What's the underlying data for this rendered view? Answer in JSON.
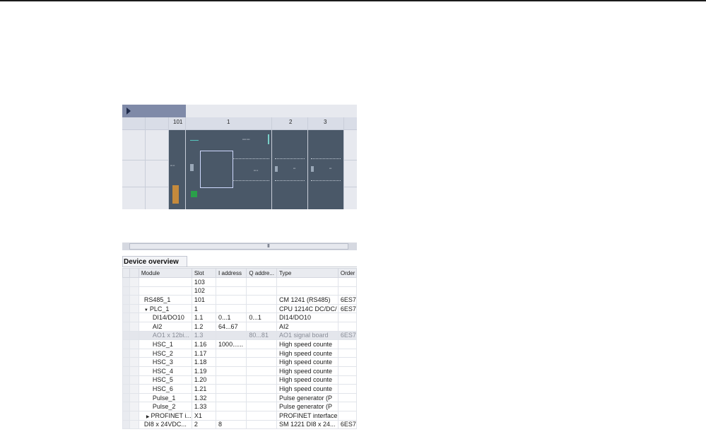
{
  "device_view": {
    "slot_numbers": [
      "101",
      "1",
      "2",
      "3"
    ]
  },
  "scrollbar": {
    "grip": "III"
  },
  "overview": {
    "title": "Device overview",
    "columns": [
      "Module",
      "Slot",
      "I address",
      "Q addre...",
      "Type",
      "Order"
    ],
    "rows": [
      {
        "module": "",
        "slot": "103",
        "i": "",
        "q": "",
        "type": "",
        "order": "",
        "indent": 0
      },
      {
        "module": "",
        "slot": "102",
        "i": "",
        "q": "",
        "type": "",
        "order": "",
        "indent": 0
      },
      {
        "module": "RS485_1",
        "slot": "101",
        "i": "",
        "q": "",
        "type": "CM 1241 (RS485)",
        "order": "6ES7",
        "indent": 1
      },
      {
        "module": "PLC_1",
        "slot": "1",
        "i": "",
        "q": "",
        "type": "CPU 1214C DC/DC/",
        "order": "6ES7",
        "indent": 0,
        "caret": "▼"
      },
      {
        "module": "DI14/DO10",
        "slot": "1.1",
        "i": "0...1",
        "q": "0...1",
        "type": "DI14/DO10",
        "order": "",
        "indent": 2
      },
      {
        "module": "AI2",
        "slot": "1.2",
        "i": "64...67",
        "q": "",
        "type": "AI2",
        "order": "",
        "indent": 2
      },
      {
        "module": "AO1 x 12bi...",
        "slot": "1.3",
        "i": "",
        "q": "80...81",
        "type": "AO1 signal board",
        "order": "6ES7",
        "indent": 2,
        "dim": true
      },
      {
        "module": "HSC_1",
        "slot": "1.16",
        "i": "1000......",
        "q": "",
        "type": "High speed counte",
        "order": "",
        "indent": 2
      },
      {
        "module": "HSC_2",
        "slot": "1.17",
        "i": "",
        "q": "",
        "type": "High speed counte",
        "order": "",
        "indent": 2
      },
      {
        "module": "HSC_3",
        "slot": "1.18",
        "i": "",
        "q": "",
        "type": "High speed counte",
        "order": "",
        "indent": 2
      },
      {
        "module": "HSC_4",
        "slot": "1.19",
        "i": "",
        "q": "",
        "type": "High speed counte",
        "order": "",
        "indent": 2
      },
      {
        "module": "HSC_5",
        "slot": "1.20",
        "i": "",
        "q": "",
        "type": "High speed counte",
        "order": "",
        "indent": 2
      },
      {
        "module": "HSC_6",
        "slot": "1.21",
        "i": "",
        "q": "",
        "type": "High speed counte",
        "order": "",
        "indent": 2
      },
      {
        "module": "Pulse_1",
        "slot": "1.32",
        "i": "",
        "q": "",
        "type": "Pulse generator (P",
        "order": "",
        "indent": 2
      },
      {
        "module": "Pulse_2",
        "slot": "1.33",
        "i": "",
        "q": "",
        "type": "Pulse generator (P",
        "order": "",
        "indent": 2
      },
      {
        "module": "PROFINET i...",
        "slot": "X1",
        "i": "",
        "q": "",
        "type": "PROFINET interface",
        "order": "",
        "indent": 2,
        "caret": "▶"
      },
      {
        "module": "DI8 x 24VDC...",
        "slot": "2",
        "i": "8",
        "q": "",
        "type": "SM 1221 DI8 x 24...",
        "order": "6ES7",
        "indent": 1
      }
    ]
  }
}
